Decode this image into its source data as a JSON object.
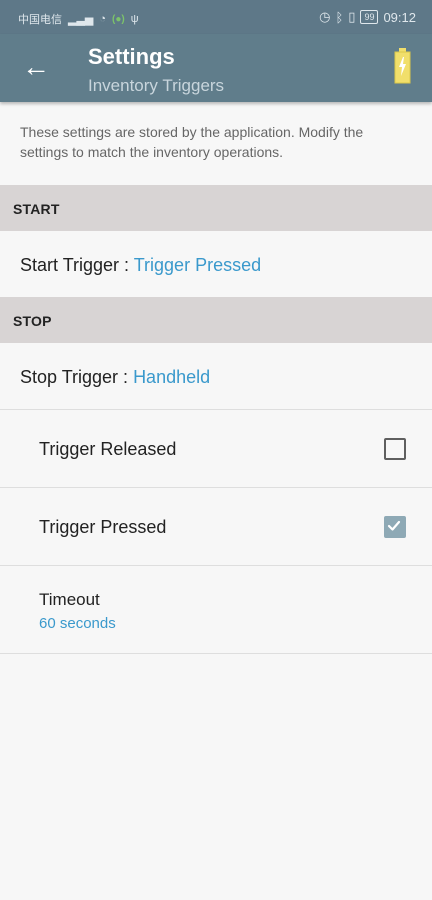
{
  "status": {
    "carrier": "中国电信",
    "signal_icon": "signal-icon",
    "wifi_icon": "wifi-icon",
    "wifi_badge": "(●)",
    "time": "09:12",
    "battery": "99"
  },
  "app_bar": {
    "title": "Settings",
    "subtitle": "Inventory Triggers"
  },
  "description": "These settings are stored by the application. Modify the settings to match the inventory operations.",
  "sections": {
    "start": "START",
    "stop": "STOP"
  },
  "start_trigger": {
    "label": "Start Trigger : ",
    "value": "Trigger Pressed"
  },
  "stop_trigger": {
    "label": "Stop Trigger : ",
    "value": "Handheld"
  },
  "options": {
    "trigger_released": "Trigger Released",
    "trigger_pressed": "Trigger Pressed",
    "timeout_title": "Timeout",
    "timeout_value": "60 seconds"
  },
  "colors": {
    "app_bar": "#607d8b",
    "accent": "#3a99cc",
    "checkbox_checked": "#8ea9b5"
  }
}
